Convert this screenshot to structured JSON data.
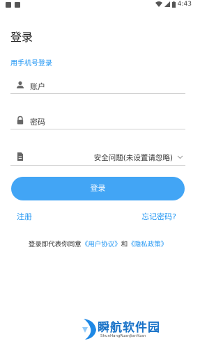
{
  "status_bar": {
    "time": "4:43"
  },
  "header": {
    "title": "登录"
  },
  "phone_login_link": "用手机号登录",
  "fields": {
    "account_placeholder": "账户",
    "password_placeholder": "密码",
    "security_question_value": "安全问题(未设置请忽略)"
  },
  "login_button": "登录",
  "register_link": "注册",
  "forgot_link": "忘记密码?",
  "agreement": {
    "prefix": "登录即代表你同意",
    "user_agreement": "《用户协议》",
    "and": "和",
    "privacy_policy": "《隐私政策》"
  },
  "watermark": {
    "title": "瞬航软件园",
    "subtitle": "ShunHangRuanJianYuan"
  },
  "colors": {
    "accent": "#2196f3",
    "button": "#42a5f5"
  }
}
